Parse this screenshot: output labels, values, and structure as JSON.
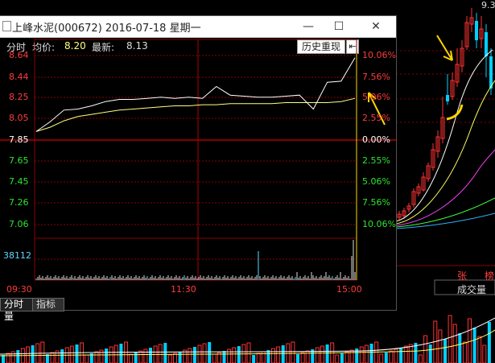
{
  "window": {
    "title": "上峰水泥(000672) 2016-07-18 星期一",
    "minimize_glyph": "—",
    "maximize_glyph": "☐",
    "close_glyph": "✕"
  },
  "info": {
    "mode_label": "分时",
    "avg_label": "均价:",
    "avg_value": "8.20",
    "latest_label": "最新:",
    "latest_value": "8.13",
    "history_button": "历史重现"
  },
  "axis": {
    "left_prices": [
      "8.64",
      "8.44",
      "8.25",
      "8.05",
      "7.85",
      "7.65",
      "7.45",
      "7.26",
      "7.06"
    ],
    "right_pcts": [
      "10.06%",
      "7.56%",
      "5.06%",
      "2.55%",
      "0.00%",
      "2.55%",
      "5.06%",
      "7.56%",
      "10.06%"
    ],
    "volume_label": "38112",
    "times": [
      "09:30",
      "11:30",
      "15:00"
    ]
  },
  "tabs": {
    "volume_tab": "分时量",
    "indicator_tab": "指标"
  },
  "background_chart": {
    "top_right_value": "9.3",
    "legend_zhang": "张",
    "legend_bang": "榜",
    "volume_label": "成交量"
  },
  "colors": {
    "up": "#ff3232",
    "down": "#00e600",
    "grid": "#8b0000",
    "axis_text_up": "#ff3b3b",
    "axis_text_down": "#2ee62e",
    "price_line": "#ffffff",
    "avg_line": "#ffff80",
    "volume_bar": "#dcdcdc",
    "highlight": "#ffd400"
  },
  "chart_data": {
    "type": "line",
    "title": "上峰水泥(000672) 2016-07-18 星期一",
    "x": [
      "09:30",
      "11:30",
      "15:00"
    ],
    "ylim": [
      7.06,
      8.64
    ],
    "series": [
      {
        "name": "最新",
        "values": [
          7.93,
          8.02,
          8.13,
          8.14,
          8.17,
          8.21,
          8.23,
          8.23,
          8.24,
          8.25,
          8.24,
          8.25,
          8.24,
          8.35,
          8.27,
          8.26,
          8.25,
          8.25,
          8.26,
          8.27,
          8.14,
          8.39,
          8.4,
          8.62
        ]
      },
      {
        "name": "均价",
        "values": [
          7.93,
          7.97,
          8.03,
          8.07,
          8.09,
          8.11,
          8.13,
          8.14,
          8.15,
          8.16,
          8.17,
          8.17,
          8.18,
          8.18,
          8.19,
          8.19,
          8.19,
          8.19,
          8.2,
          8.2,
          8.2,
          8.2,
          8.21,
          8.24
        ]
      }
    ],
    "volume_max": 38112
  }
}
